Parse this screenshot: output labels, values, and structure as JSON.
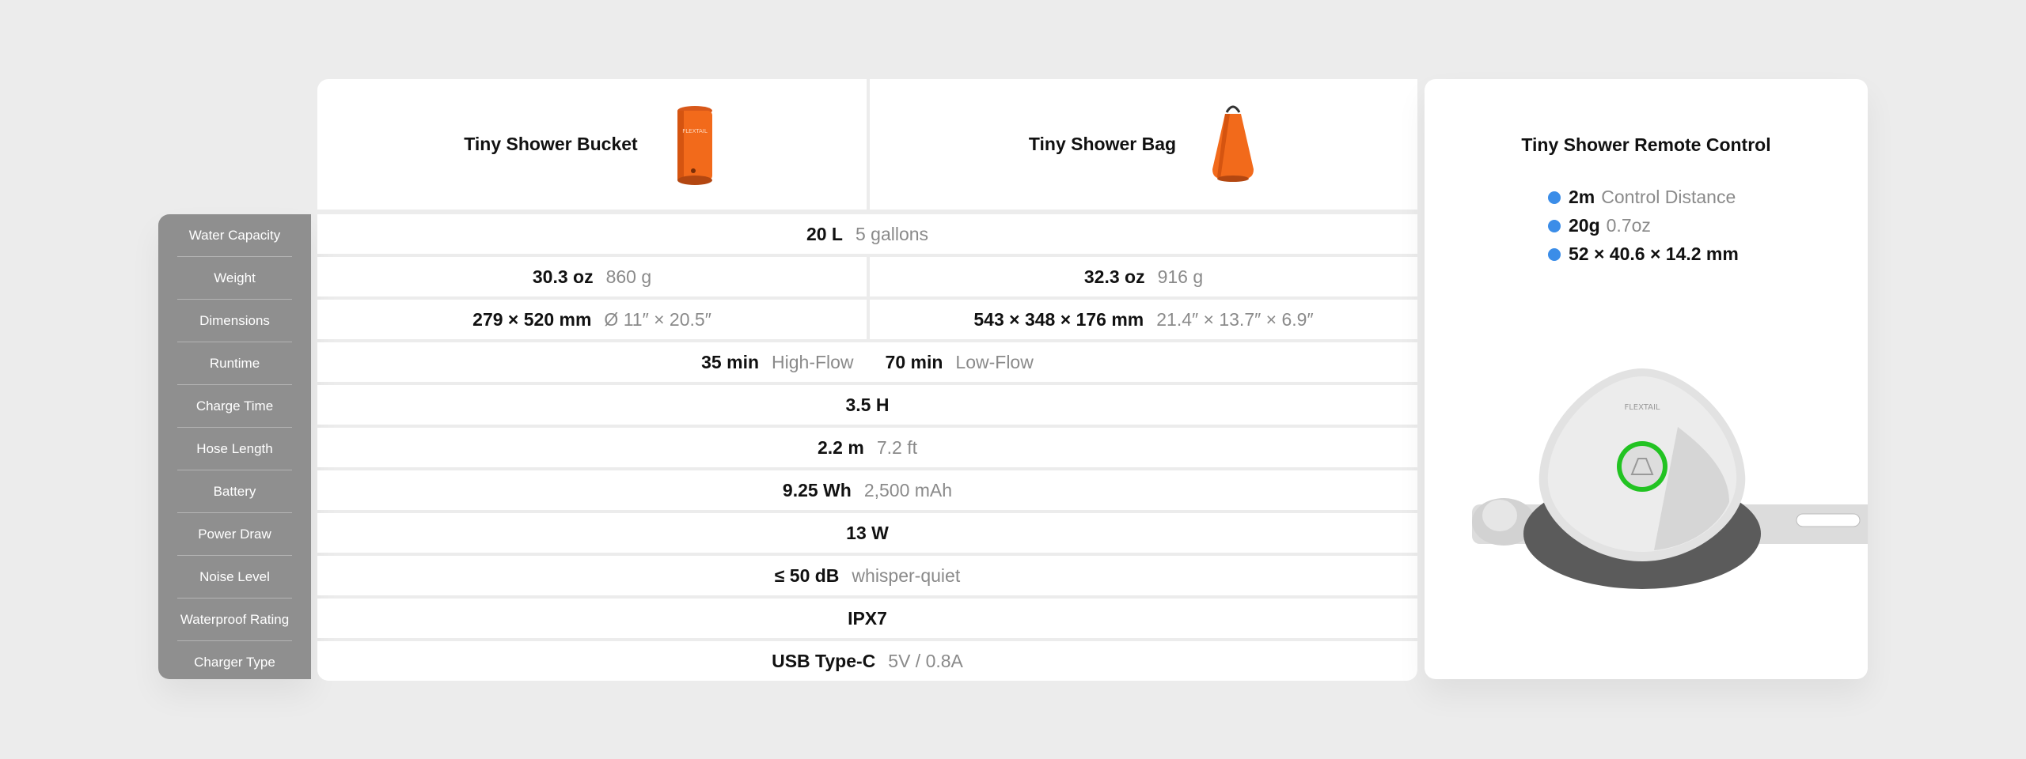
{
  "products": {
    "bucket": {
      "name": "Tiny Shower Bucket",
      "color": "#f26a1b"
    },
    "bag": {
      "name": "Tiny Shower Bag",
      "color": "#f26a1b"
    },
    "remote": {
      "name": "Tiny Shower Remote Control"
    }
  },
  "row_labels": [
    "Water Capacity",
    "Weight",
    "Dimensions",
    "Runtime",
    "Charge Time",
    "Hose Length",
    "Battery",
    "Power Draw",
    "Noise Level",
    "Waterproof Rating",
    "Charger Type"
  ],
  "specs": {
    "water_capacity": {
      "main": "20 L",
      "sub": "5 gallons"
    },
    "weight": {
      "bucket": {
        "main": "30.3 oz",
        "sub": "860 g"
      },
      "bag": {
        "main": "32.3 oz",
        "sub": "916 g"
      }
    },
    "dimensions": {
      "bucket": {
        "main": "279 × 520 mm",
        "sub": "Ø 11″ × 20.5″"
      },
      "bag": {
        "main": "543 × 348 × 176 mm",
        "sub": "21.4″ × 13.7″ × 6.9″"
      }
    },
    "runtime": {
      "high": "35 min",
      "high_label": "High-Flow",
      "low": "70 min",
      "low_label": "Low-Flow"
    },
    "charge_time": {
      "main": "3.5 H"
    },
    "hose_length": {
      "main": "2.2 m",
      "sub": "7.2 ft"
    },
    "battery": {
      "main": "9.25 Wh",
      "sub": "2,500 mAh"
    },
    "power_draw": {
      "main": "13 W"
    },
    "noise_level": {
      "main": "≤ 50 dB",
      "sub": "whisper-quiet"
    },
    "waterproof": {
      "main": "IPX7"
    },
    "charger_type": {
      "main": "USB Type-C",
      "sub": "5V / 0.8A"
    }
  },
  "remote_specs": [
    {
      "main": "2m",
      "sub": "Control Distance"
    },
    {
      "main": "20g",
      "sub": "0.7oz"
    },
    {
      "main": "52 × 40.6 × 14.2 mm",
      "sub": ""
    }
  ],
  "colors": {
    "accent_dot": "#3b8de8",
    "ring": "#22c322",
    "label_col": "#8f8f8f"
  }
}
